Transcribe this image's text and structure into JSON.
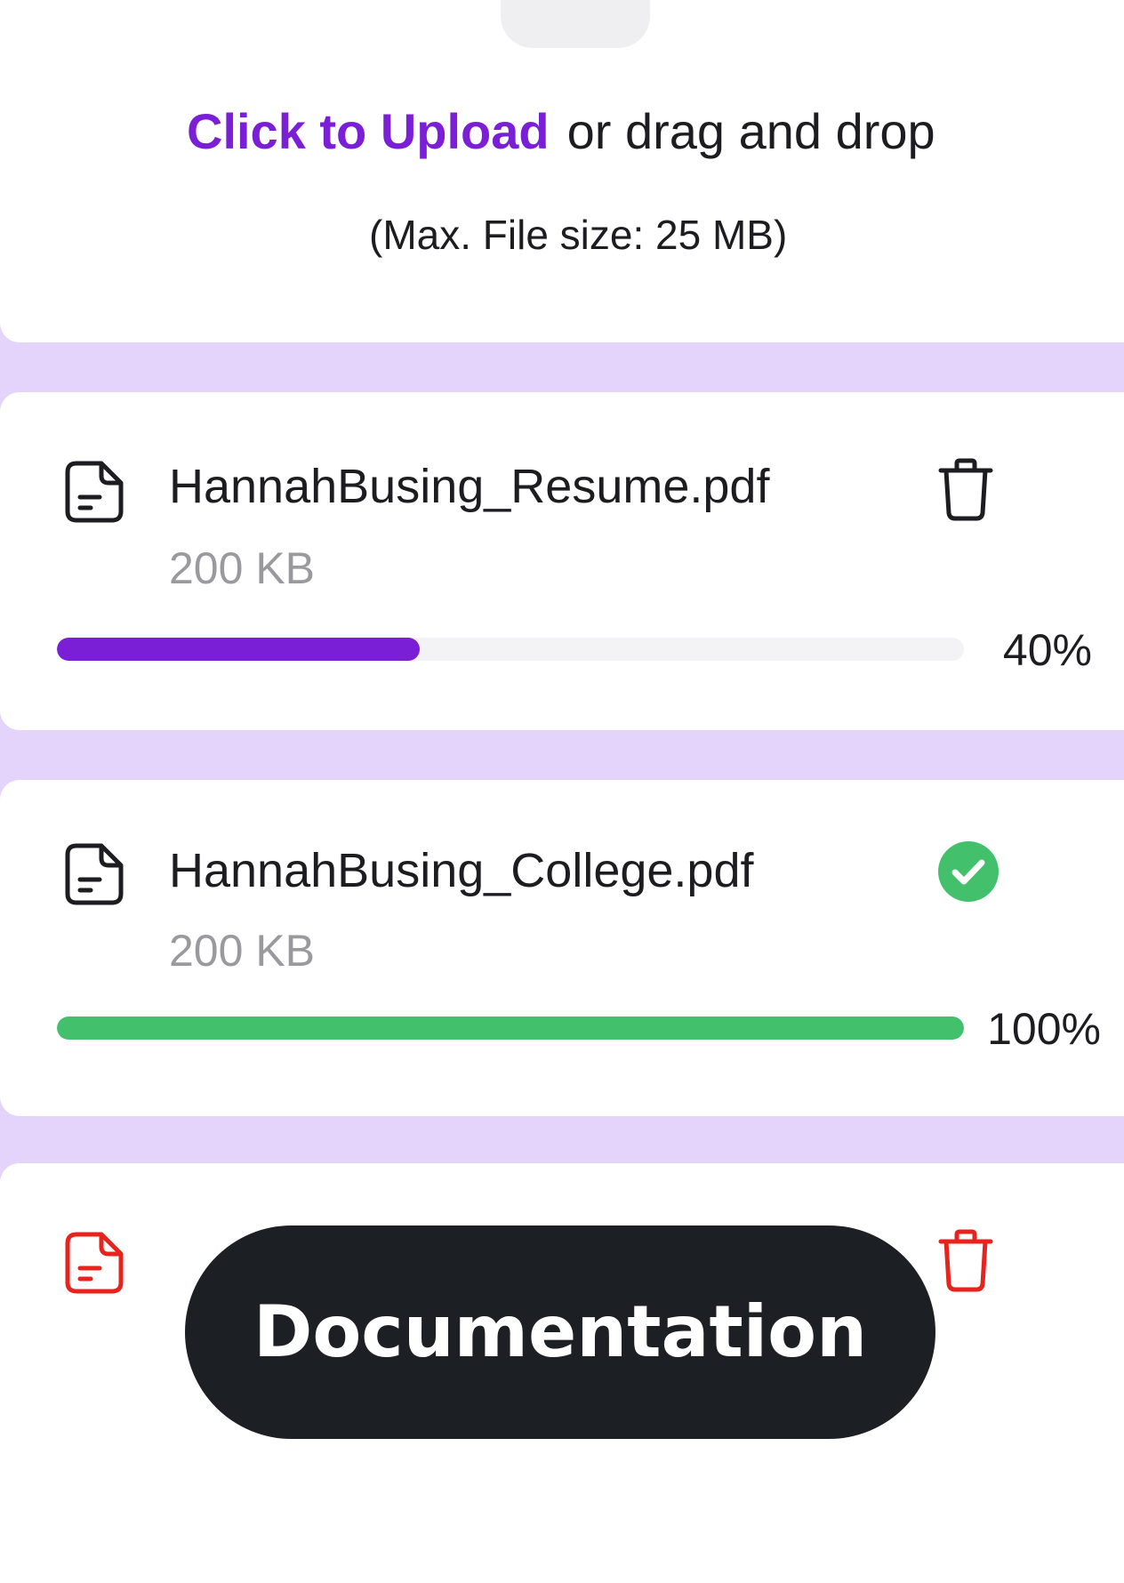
{
  "upload": {
    "link_text": "Click to Upload",
    "rest_text": "or drag and drop",
    "hint": "(Max. File size: 25 MB)",
    "icon": "upload-icon"
  },
  "files": [
    {
      "name": "HannahBusing_Resume.pdf",
      "size": "200 KB",
      "progress": 40,
      "progress_label": "40%",
      "status": "uploading",
      "action_icon": "trash-icon",
      "color": "#7a1fd6"
    },
    {
      "name": "HannahBusing_College.pdf",
      "size": "200 KB",
      "progress": 100,
      "progress_label": "100%",
      "status": "complete",
      "action_icon": "check-circle-icon",
      "color": "#43c06c"
    },
    {
      "name": "",
      "size": "",
      "status": "error",
      "action_icon": "trash-icon",
      "color": "#e8231e"
    }
  ],
  "documentation_button": {
    "label": "Documentation"
  },
  "colors": {
    "accent": "#7a1fd6",
    "success": "#43c06c",
    "error": "#e8231e",
    "background": "#e4d3fb",
    "pill": "#1c2025"
  }
}
